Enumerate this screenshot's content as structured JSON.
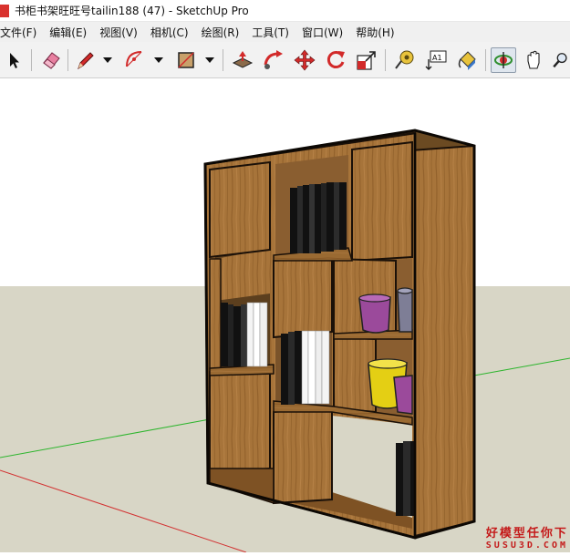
{
  "window": {
    "title": "书柜书架旺旺号tailin188 (47) - SketchUp Pro"
  },
  "menu": {
    "items": [
      {
        "label": "文件(F)"
      },
      {
        "label": "编辑(E)"
      },
      {
        "label": "视图(V)"
      },
      {
        "label": "相机(C)"
      },
      {
        "label": "绘图(R)"
      },
      {
        "label": "工具(T)"
      },
      {
        "label": "窗口(W)"
      },
      {
        "label": "帮助(H)"
      }
    ]
  },
  "toolbar": {
    "tools": [
      {
        "icon": "select-arrow-icon"
      },
      {
        "icon": "eraser-icon"
      },
      {
        "icon": "pencil-icon"
      },
      {
        "icon": "arc-icon"
      },
      {
        "icon": "rectangle-icon"
      },
      {
        "icon": "push-pull-icon"
      },
      {
        "icon": "follow-me-icon"
      },
      {
        "icon": "move-icon"
      },
      {
        "icon": "rotate-icon"
      },
      {
        "icon": "scale-icon"
      },
      {
        "icon": "tape-measure-icon"
      },
      {
        "icon": "text-label-icon"
      },
      {
        "icon": "paint-bucket-icon"
      },
      {
        "icon": "orbit-icon"
      },
      {
        "icon": "pan-hand-icon"
      },
      {
        "icon": "zoom-icon"
      }
    ],
    "text_tool_label": "A1",
    "active_tool": "orbit-icon"
  },
  "viewport": {
    "sky_color": "#ffffff",
    "ground_color": "#d8d6c6",
    "wood_color": "#a7743a"
  },
  "watermark": {
    "line1": "好模型任你下",
    "line2": "SUSU3D.COM"
  }
}
